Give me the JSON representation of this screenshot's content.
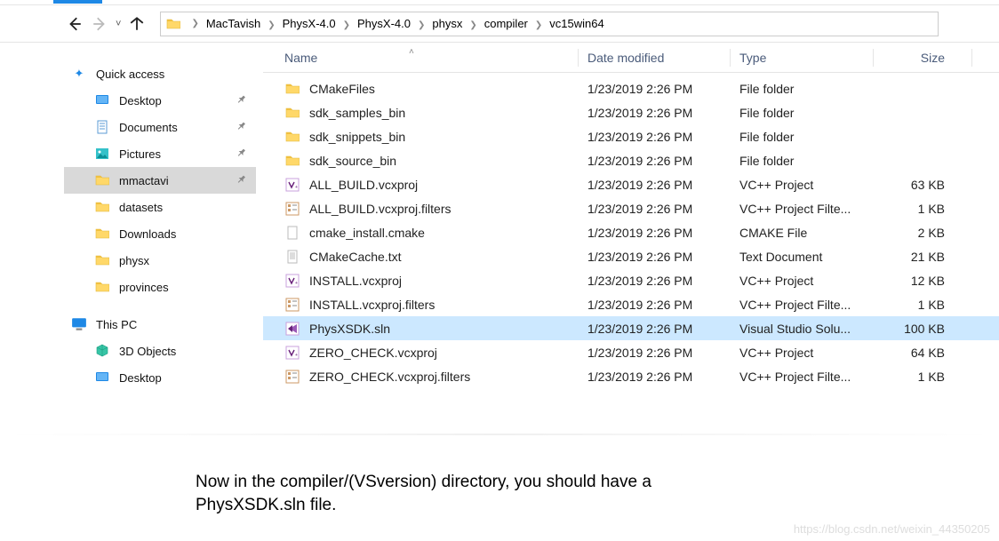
{
  "breadcrumbs": [
    "MacTavish",
    "PhysX-4.0",
    "PhysX-4.0",
    "physx",
    "compiler",
    "vc15win64"
  ],
  "columns": {
    "name": "Name",
    "date": "Date modified",
    "type": "Type",
    "size": "Size"
  },
  "nav": {
    "quick_access": "Quick access",
    "items": [
      {
        "label": "Desktop",
        "icon": "desktop",
        "pinned": true
      },
      {
        "label": "Documents",
        "icon": "doc",
        "pinned": true
      },
      {
        "label": "Pictures",
        "icon": "pictures",
        "pinned": true
      },
      {
        "label": "mmactavi",
        "icon": "folder",
        "pinned": true,
        "selected": true
      },
      {
        "label": "datasets",
        "icon": "folder",
        "pinned": false
      },
      {
        "label": "Downloads",
        "icon": "folder",
        "pinned": false
      },
      {
        "label": "physx",
        "icon": "folder",
        "pinned": false
      },
      {
        "label": "provinces",
        "icon": "folder",
        "pinned": false
      }
    ],
    "thispc": "This PC",
    "pc_items": [
      {
        "label": "3D Objects",
        "icon": "shape3d"
      },
      {
        "label": "Desktop",
        "icon": "desktop"
      }
    ]
  },
  "files": [
    {
      "name": "CMakeFiles",
      "date": "1/23/2019 2:26 PM",
      "type": "File folder",
      "size": "",
      "icon": "folder"
    },
    {
      "name": "sdk_samples_bin",
      "date": "1/23/2019 2:26 PM",
      "type": "File folder",
      "size": "",
      "icon": "folder"
    },
    {
      "name": "sdk_snippets_bin",
      "date": "1/23/2019 2:26 PM",
      "type": "File folder",
      "size": "",
      "icon": "folder"
    },
    {
      "name": "sdk_source_bin",
      "date": "1/23/2019 2:26 PM",
      "type": "File folder",
      "size": "",
      "icon": "folder"
    },
    {
      "name": "ALL_BUILD.vcxproj",
      "date": "1/23/2019 2:26 PM",
      "type": "VC++ Project",
      "size": "63 KB",
      "icon": "vcx"
    },
    {
      "name": "ALL_BUILD.vcxproj.filters",
      "date": "1/23/2019 2:26 PM",
      "type": "VC++ Project Filte...",
      "size": "1 KB",
      "icon": "filters"
    },
    {
      "name": "cmake_install.cmake",
      "date": "1/23/2019 2:26 PM",
      "type": "CMAKE File",
      "size": "2 KB",
      "icon": "blank"
    },
    {
      "name": "CMakeCache.txt",
      "date": "1/23/2019 2:26 PM",
      "type": "Text Document",
      "size": "21 KB",
      "icon": "txt"
    },
    {
      "name": "INSTALL.vcxproj",
      "date": "1/23/2019 2:26 PM",
      "type": "VC++ Project",
      "size": "12 KB",
      "icon": "vcx"
    },
    {
      "name": "INSTALL.vcxproj.filters",
      "date": "1/23/2019 2:26 PM",
      "type": "VC++ Project Filte...",
      "size": "1 KB",
      "icon": "filters"
    },
    {
      "name": "PhysXSDK.sln",
      "date": "1/23/2019 2:26 PM",
      "type": "Visual Studio Solu...",
      "size": "100 KB",
      "icon": "sln",
      "selected": true
    },
    {
      "name": "ZERO_CHECK.vcxproj",
      "date": "1/23/2019 2:26 PM",
      "type": "VC++ Project",
      "size": "64 KB",
      "icon": "vcx"
    },
    {
      "name": "ZERO_CHECK.vcxproj.filters",
      "date": "1/23/2019 2:26 PM",
      "type": "VC++ Project Filte...",
      "size": "1 KB",
      "icon": "filters"
    }
  ],
  "caption": "Now in the compiler/(VSversion) directory, you should have a PhysXSDK.sln file.",
  "watermark": "https://blog.csdn.net/weixin_44350205"
}
